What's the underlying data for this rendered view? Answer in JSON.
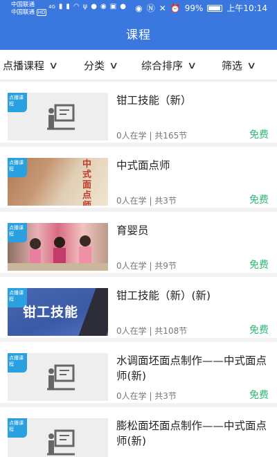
{
  "status_bar": {
    "carrier_1": "中国联通",
    "carrier_2": "中国联通",
    "hd_badge": "HD",
    "network": "4G",
    "battery": "99%",
    "time": "上午10:14"
  },
  "header": {
    "title": "课程"
  },
  "filters": [
    {
      "label": "点播课程"
    },
    {
      "label": "分类"
    },
    {
      "label": "综合排序"
    },
    {
      "label": "筛选"
    }
  ],
  "badge_text": "点播课程",
  "courses": [
    {
      "title": "钳工技能（新）",
      "meta": "0人在学 | 共165节",
      "price": "免费",
      "thumb": "placeholder"
    },
    {
      "title": "中式面点师",
      "meta": "0人在学 | 共3节",
      "price": "免费",
      "thumb": "photo",
      "thumb_text": "中式面点师"
    },
    {
      "title": "育婴员",
      "meta": "0人在学 | 共9节",
      "price": "免费",
      "thumb": "photo"
    },
    {
      "title": "钳工技能（新）(新)",
      "meta": "0人在学 | 共108节",
      "price": "免费",
      "thumb": "banner",
      "thumb_text": "钳工技能"
    },
    {
      "title": "水调面坯面点制作——中式面点师(新)",
      "meta": "0人在学 | 共3节",
      "price": "免费",
      "thumb": "placeholder"
    },
    {
      "title": "膨松面坯面点制作——中式面点师(新)",
      "meta": "",
      "price": "",
      "thumb": "placeholder"
    }
  ],
  "colors": {
    "header_bg": "#3a78e0",
    "price": "#2eb872",
    "badge": "#2aa0e0"
  }
}
